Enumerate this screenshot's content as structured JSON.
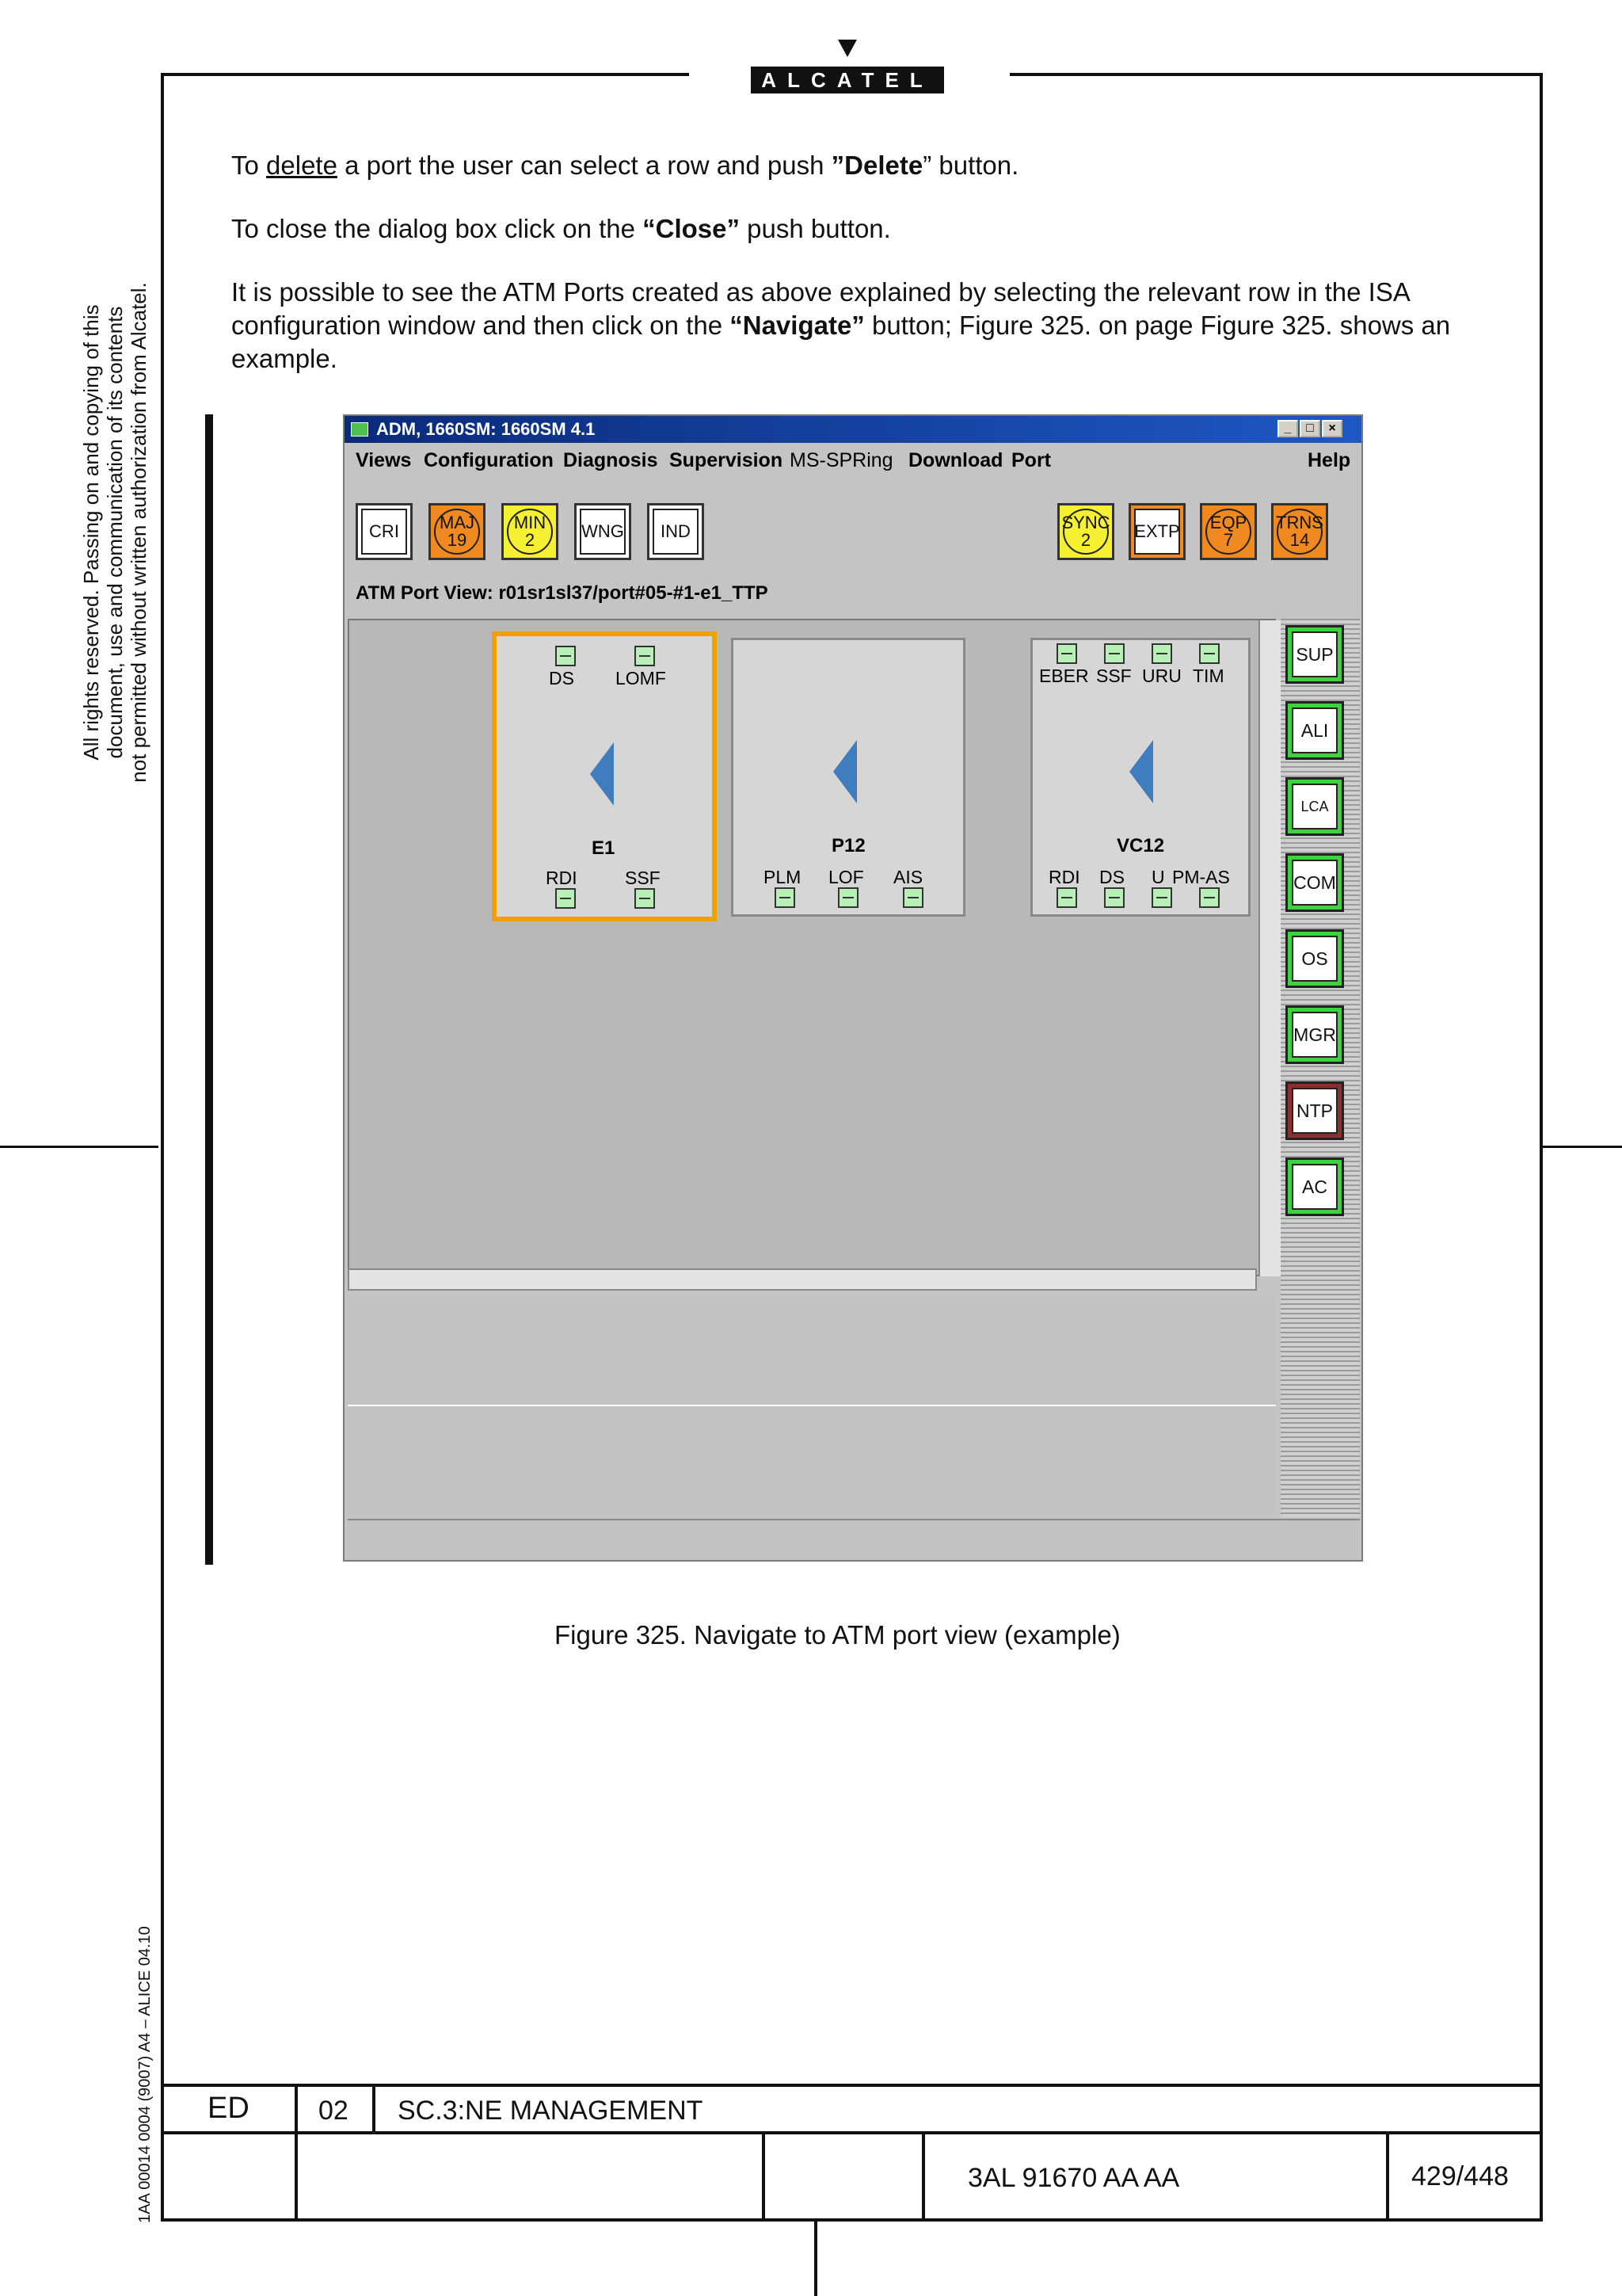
{
  "brand": {
    "logo_text": "ALCATEL"
  },
  "side_text": {
    "copyright_lines": [
      "All rights reserved. Passing on and copying of this",
      "document, use and communication of its contents",
      "not permitted without written authorization from Alcatel."
    ],
    "code": "1AA 00014 0004 (9007) A4 – ALICE 04.10"
  },
  "body": {
    "p1": {
      "a": "To ",
      "u": "delete",
      "b": " a port the user can select a row and push ",
      "bold": "”Delete",
      "c": "” button."
    },
    "p2": {
      "a": "To close the dialog box click on the ",
      "bold": "“Close”",
      "c": " push button."
    },
    "p3": {
      "a": "It is possible to see the ATM  Ports created as above explained by selecting  the relevant row in the ISA configuration window and then click on the ",
      "bold": "“Navigate”",
      "c": " button;  Figure 325.  on page Figure 325.  shows an example."
    }
  },
  "window": {
    "title": "ADM, 1660SM: 1660SM 4.1",
    "controls": [
      "_",
      "□",
      "×"
    ],
    "menu": [
      "Views",
      "Configuration",
      "Diagnosis",
      "Supervision",
      "MS-SPRing",
      "Download",
      "Port",
      "Help"
    ],
    "alarm_buttons": [
      {
        "label": "CRI",
        "count": ""
      },
      {
        "label": "MAJ",
        "count": "19"
      },
      {
        "label": "MIN",
        "count": "2"
      },
      {
        "label": "WNG",
        "count": ""
      },
      {
        "label": "IND",
        "count": ""
      }
    ],
    "right_buttons": [
      {
        "label": "SYNC",
        "count": "2"
      },
      {
        "label": "EXTP",
        "count": ""
      },
      {
        "label": "EQP",
        "count": "7"
      },
      {
        "label": "TRNS",
        "count": "14"
      }
    ],
    "view_label": "ATM Port View: r01sr1sl37/port#05-#1-e1_TTP",
    "cards": [
      {
        "name": "E1",
        "top_leds": [
          "DS",
          "LOMF"
        ],
        "bottom_leds": [
          "RDI",
          "SSF"
        ]
      },
      {
        "name": "P12",
        "top_leds": [],
        "bottom_leds": [
          "PLM",
          "LOF",
          "AIS"
        ]
      },
      {
        "name": "VC12",
        "top_leds": [
          "EBER",
          "SSF",
          "URU",
          "TIM"
        ],
        "bottom_leds": [
          "RDI",
          "DS",
          "U",
          "PM-AS"
        ]
      }
    ],
    "side_buttons": [
      "SUP",
      "ALI",
      "LCA",
      "COM",
      "OS",
      "MGR",
      "NTP",
      "AC"
    ],
    "colors": {
      "orange": "#f08a20",
      "yellow": "#f5f032",
      "green": "#3fd23f",
      "ntp": "#8a3030",
      "selection": "#f0a000"
    }
  },
  "caption": "Figure 325. Navigate to ATM port view (example)",
  "footer": {
    "ed_label": "ED",
    "ed_value": "02",
    "section": "SC.3:NE MANAGEMENT",
    "doc_number": "3AL 91670 AA  AA",
    "page": "429/448"
  }
}
